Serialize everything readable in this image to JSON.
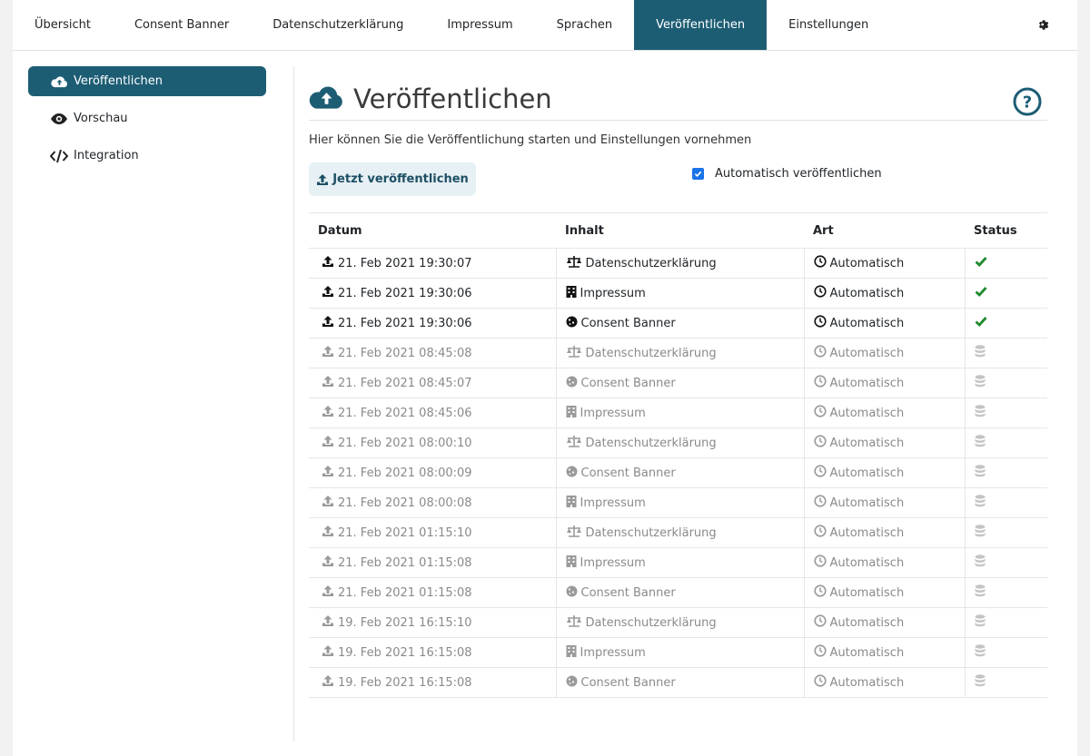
{
  "topnav": {
    "tabs": [
      {
        "label": "Übersicht",
        "active": false
      },
      {
        "label": "Consent Banner",
        "active": false
      },
      {
        "label": "Datenschutzerklärung",
        "active": false
      },
      {
        "label": "Impressum",
        "active": false
      },
      {
        "label": "Sprachen",
        "active": false
      },
      {
        "label": "Veröffentlichen",
        "active": true
      },
      {
        "label": "Einstellungen",
        "active": false
      }
    ],
    "settings_icon": "gear-icon"
  },
  "sidebar": {
    "items": [
      {
        "label": "Veröffentlichen",
        "icon": "cloud-upload-icon",
        "active": true
      },
      {
        "label": "Vorschau",
        "icon": "eye-icon",
        "active": false
      },
      {
        "label": "Integration",
        "icon": "code-icon",
        "active": false
      }
    ]
  },
  "main": {
    "title": "Veröffentlichen",
    "subtitle": "Hier können Sie die Veröffentlichung starten und Einstellungen vornehmen",
    "publish_button": "Jetzt veröffentlichen",
    "auto_publish_label": "Automatisch veröffentlichen",
    "auto_publish_checked": true
  },
  "table": {
    "headers": [
      "Datum",
      "Inhalt",
      "Art",
      "Status"
    ],
    "rows": [
      {
        "date": "21. Feb 2021 19:30:07",
        "content": "Datenschutzerklärung",
        "type": "Automatisch",
        "status": "success",
        "current": true
      },
      {
        "date": "21. Feb 2021 19:30:06",
        "content": "Impressum",
        "type": "Automatisch",
        "status": "success",
        "current": true
      },
      {
        "date": "21. Feb 2021 19:30:06",
        "content": "Consent Banner",
        "type": "Automatisch",
        "status": "success",
        "current": true
      },
      {
        "date": "21. Feb 2021 08:45:08",
        "content": "Datenschutzerklärung",
        "type": "Automatisch",
        "status": "archived",
        "current": false
      },
      {
        "date": "21. Feb 2021 08:45:07",
        "content": "Consent Banner",
        "type": "Automatisch",
        "status": "archived",
        "current": false
      },
      {
        "date": "21. Feb 2021 08:45:06",
        "content": "Impressum",
        "type": "Automatisch",
        "status": "archived",
        "current": false
      },
      {
        "date": "21. Feb 2021 08:00:10",
        "content": "Datenschutzerklärung",
        "type": "Automatisch",
        "status": "archived",
        "current": false
      },
      {
        "date": "21. Feb 2021 08:00:09",
        "content": "Consent Banner",
        "type": "Automatisch",
        "status": "archived",
        "current": false
      },
      {
        "date": "21. Feb 2021 08:00:08",
        "content": "Impressum",
        "type": "Automatisch",
        "status": "archived",
        "current": false
      },
      {
        "date": "21. Feb 2021 01:15:10",
        "content": "Datenschutzerklärung",
        "type": "Automatisch",
        "status": "archived",
        "current": false
      },
      {
        "date": "21. Feb 2021 01:15:08",
        "content": "Impressum",
        "type": "Automatisch",
        "status": "archived",
        "current": false
      },
      {
        "date": "21. Feb 2021 01:15:08",
        "content": "Consent Banner",
        "type": "Automatisch",
        "status": "archived",
        "current": false
      },
      {
        "date": "19. Feb 2021 16:15:10",
        "content": "Datenschutzerklärung",
        "type": "Automatisch",
        "status": "archived",
        "current": false
      },
      {
        "date": "19. Feb 2021 16:15:08",
        "content": "Impressum",
        "type": "Automatisch",
        "status": "archived",
        "current": false
      },
      {
        "date": "19. Feb 2021 16:15:08",
        "content": "Consent Banner",
        "type": "Automatisch",
        "status": "archived",
        "current": false
      }
    ]
  },
  "colors": {
    "primary": "#1d5d74",
    "success": "#1e8a2e",
    "muted": "#8a8a8a",
    "button_bg": "#e6f0f5"
  }
}
